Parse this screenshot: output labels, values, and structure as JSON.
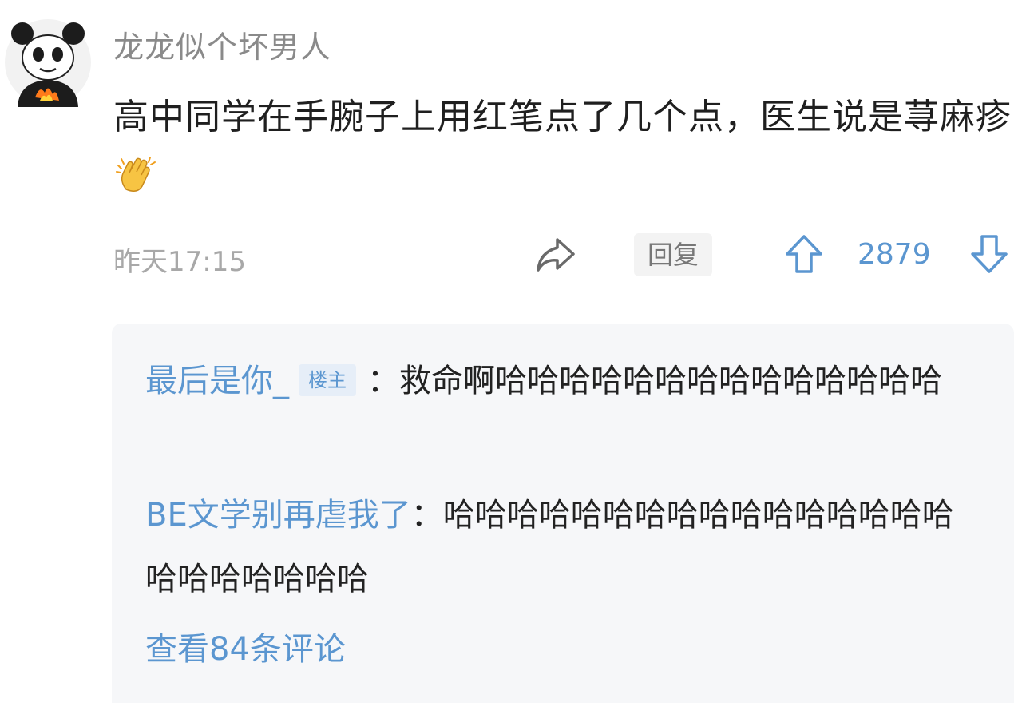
{
  "post": {
    "username": "龙龙似个坏男人",
    "text": "高中同学在手腕子上用红笔点了几个点，医生说是荨麻疹",
    "emoji": "clapping-hands-icon",
    "timestamp": "昨天17:15",
    "reply_label": "回复",
    "vote_count": "2879"
  },
  "replies": [
    {
      "author": "最后是你_",
      "badge": "楼主",
      "separator": "：",
      "text": "救命啊哈哈哈哈哈哈哈哈哈哈哈哈哈哈"
    },
    {
      "author": "BE文学别再虐我了",
      "separator": "：",
      "text": "哈哈哈哈哈哈哈哈哈哈哈哈哈哈哈哈哈哈哈哈哈哈哈"
    }
  ],
  "view_more": "查看84条评论",
  "colors": {
    "link_blue": "#5b96d0",
    "text_dark": "#1f1f1f",
    "text_gray": "#8a8a8a",
    "reply_bg": "#f6f7f9"
  }
}
